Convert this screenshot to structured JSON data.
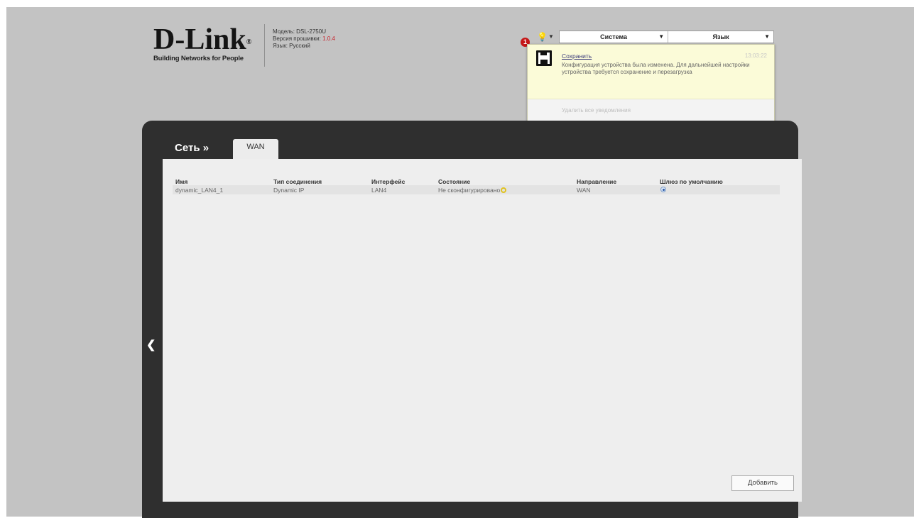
{
  "header": {
    "logo": "D-Link",
    "logo_reg": "®",
    "tagline": "Building Networks for People",
    "model_label": "Модель:",
    "model_value": "DSL-2750U",
    "firmware_label": "Версия прошивки:",
    "firmware_value": "1.0.4",
    "language_label": "Язык:",
    "language_value": "Русский"
  },
  "topmenu": {
    "notification_count": "1",
    "bulb_icon": "lightbulb-icon",
    "system_label": "Система",
    "language_label": "Язык",
    "caret": "▼"
  },
  "notification": {
    "icon": "floppy-disk-icon",
    "title": "Сохранить",
    "time": "13:03:22",
    "text": "Конфигурация устройства была изменена. Для дальнейшей настройки устройства требуется сохранение и перезагрузка",
    "clear_label": "Удалить все уведомления"
  },
  "breadcrumb": {
    "section": "Сеть »",
    "tab": "WAN"
  },
  "table": {
    "columns": [
      "Имя",
      "Тип соединения",
      "Интерфейс",
      "Состояние",
      "Направление",
      "Шлюз по умолчанию"
    ],
    "rows": [
      {
        "name": "dynamic_LAN4_1",
        "type": "Dynamic IP",
        "interface": "LAN4",
        "state": "Не сконфигурировано",
        "direction": "WAN",
        "default_gateway": true
      }
    ]
  },
  "buttons": {
    "add_label": "Добавить",
    "back_arrow": "❮"
  },
  "colors": {
    "accent_red": "#c8202a",
    "frame": "#2f2f2f",
    "notification_bg": "#fbfbd8"
  }
}
